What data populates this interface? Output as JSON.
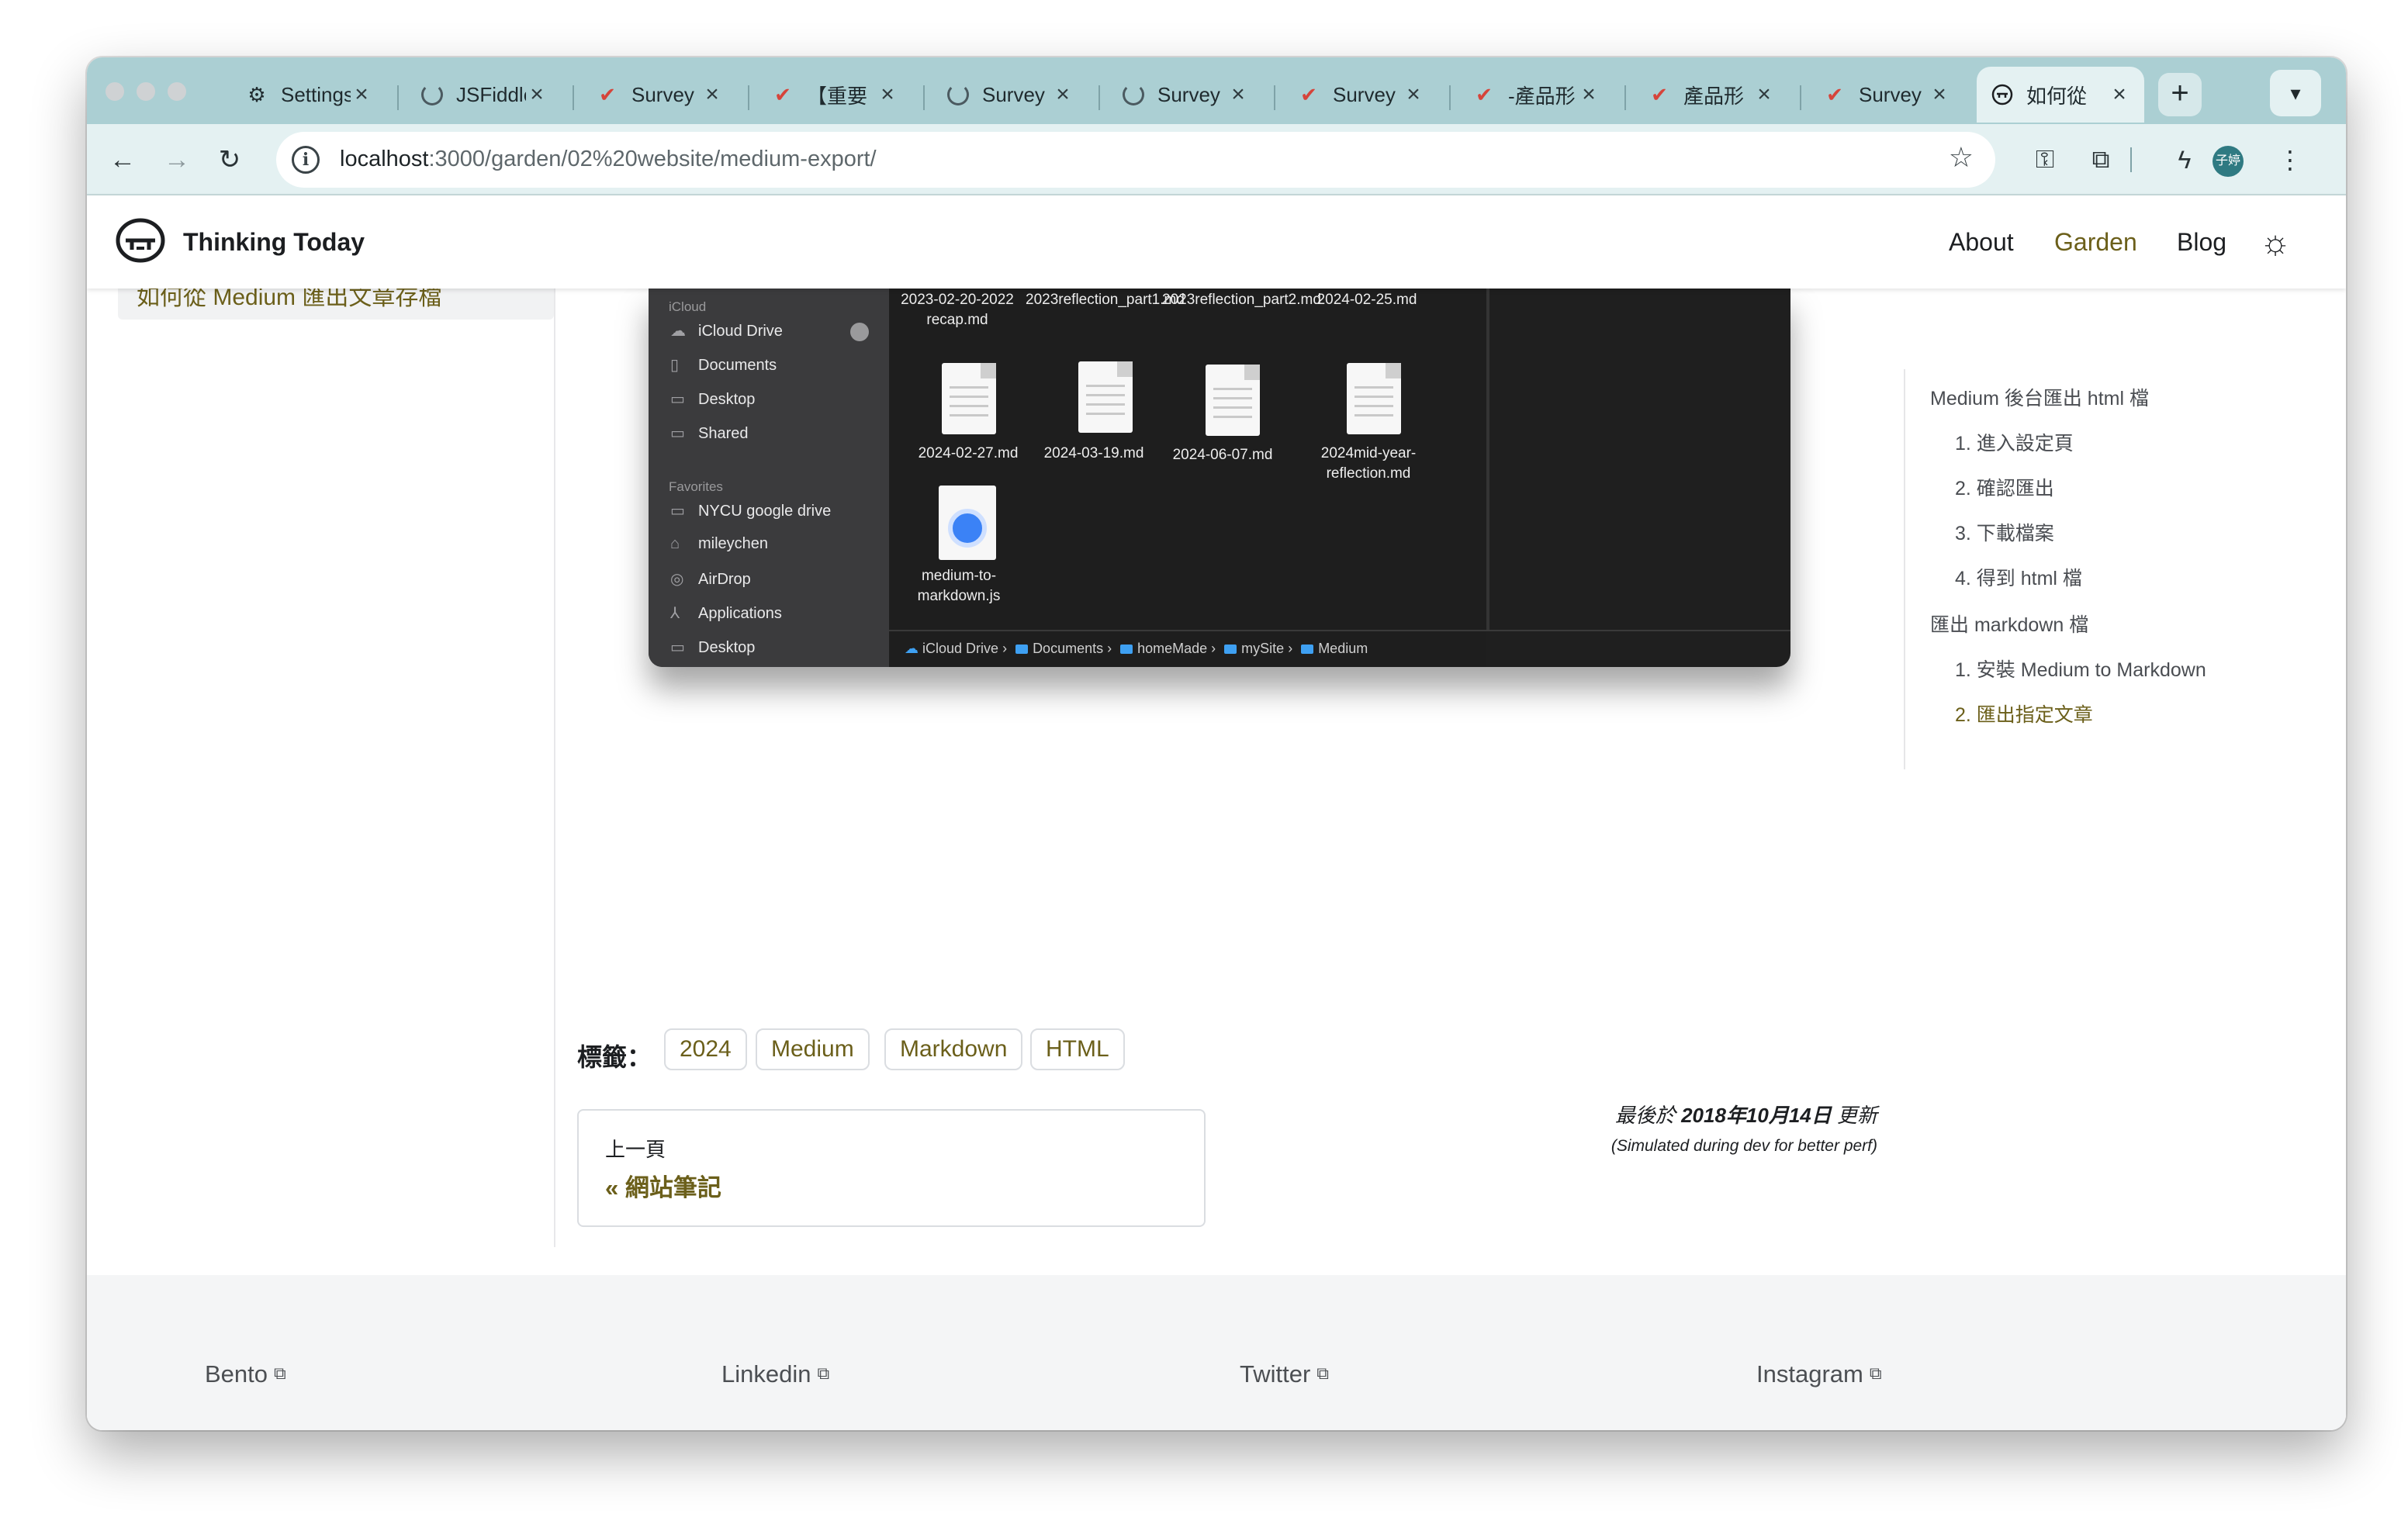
{
  "browser": {
    "tabs": [
      {
        "title": "Settings",
        "icon": "gear-icon"
      },
      {
        "title": "JSFiddle",
        "icon": "spinner-icon"
      },
      {
        "title": "Survey",
        "icon": "check-icon"
      },
      {
        "title": "【重要",
        "icon": "check-icon"
      },
      {
        "title": "Survey",
        "icon": "spinner-icon"
      },
      {
        "title": "Survey",
        "icon": "spinner-icon"
      },
      {
        "title": "Survey",
        "icon": "check-icon"
      },
      {
        "title": "-產品形",
        "icon": "check-icon"
      },
      {
        "title": "產品形",
        "icon": "check-icon"
      },
      {
        "title": "Survey",
        "icon": "check-icon"
      },
      {
        "title": "如何從",
        "icon": "site-logo-icon"
      }
    ],
    "url_host": "localhost",
    "url_rest": ":3000/garden/02%20website/medium-export/",
    "profile_label": "子婷"
  },
  "site": {
    "title": "Thinking Today",
    "nav": [
      "About",
      "Garden",
      "Blog"
    ]
  },
  "sidebar": {
    "active_item": "如何從 Medium 匯出文章存檔"
  },
  "finder": {
    "sidebar_sections": [
      "iCloud",
      "Favorites"
    ],
    "icloud_items": [
      "iCloud Drive",
      "Documents",
      "Desktop",
      "Shared"
    ],
    "favorite_items": [
      "NYCU google drive",
      "mileychen",
      "AirDrop",
      "Applications",
      "Desktop"
    ],
    "files_row1": [
      "2023-02-20-2022 recap.md",
      "2023reflection_part1.md",
      "2023reflection_part2.md",
      "2024-02-25.md"
    ],
    "files_row2": [
      "2024-02-27.md",
      "2024-03-19.md",
      "2024-06-07.md",
      "2024mid-year-reflection.md"
    ],
    "files_row3": [
      "medium-to-markdown.js"
    ],
    "path": [
      "iCloud Drive",
      "Documents",
      "homeMade",
      "mySite",
      "Medium"
    ]
  },
  "toc": [
    {
      "label": "Medium 後台匯出 html 檔",
      "level": 1
    },
    {
      "label": "1. 進入設定頁",
      "level": 2
    },
    {
      "label": "2. 確認匯出",
      "level": 2
    },
    {
      "label": "3. 下載檔案",
      "level": 2
    },
    {
      "label": "4. 得到 html 檔",
      "level": 2
    },
    {
      "label": "匯出 markdown 檔",
      "level": 1
    },
    {
      "label": "1. 安裝 Medium to Markdown",
      "level": 2
    },
    {
      "label": "2. 匯出指定文章",
      "level": 2,
      "active": true
    }
  ],
  "tags": {
    "label": "標籤：",
    "items": [
      "2024",
      "Medium",
      "Markdown",
      "HTML"
    ]
  },
  "meta": {
    "updated_prefix": "最後於",
    "updated_date": "2018年10月14日",
    "updated_suffix": "更新",
    "dev_note": "(Simulated during dev for better perf)"
  },
  "pager": {
    "sub": "上一頁",
    "title": "« 網站筆記"
  },
  "footer": {
    "links": [
      "Bento",
      "Linkedin",
      "Twitter",
      "Instagram"
    ]
  },
  "colors": {
    "accent": "#6b5f1a",
    "tabstrip": "#abcfd3",
    "footer_bg": "#f4f5f6"
  }
}
